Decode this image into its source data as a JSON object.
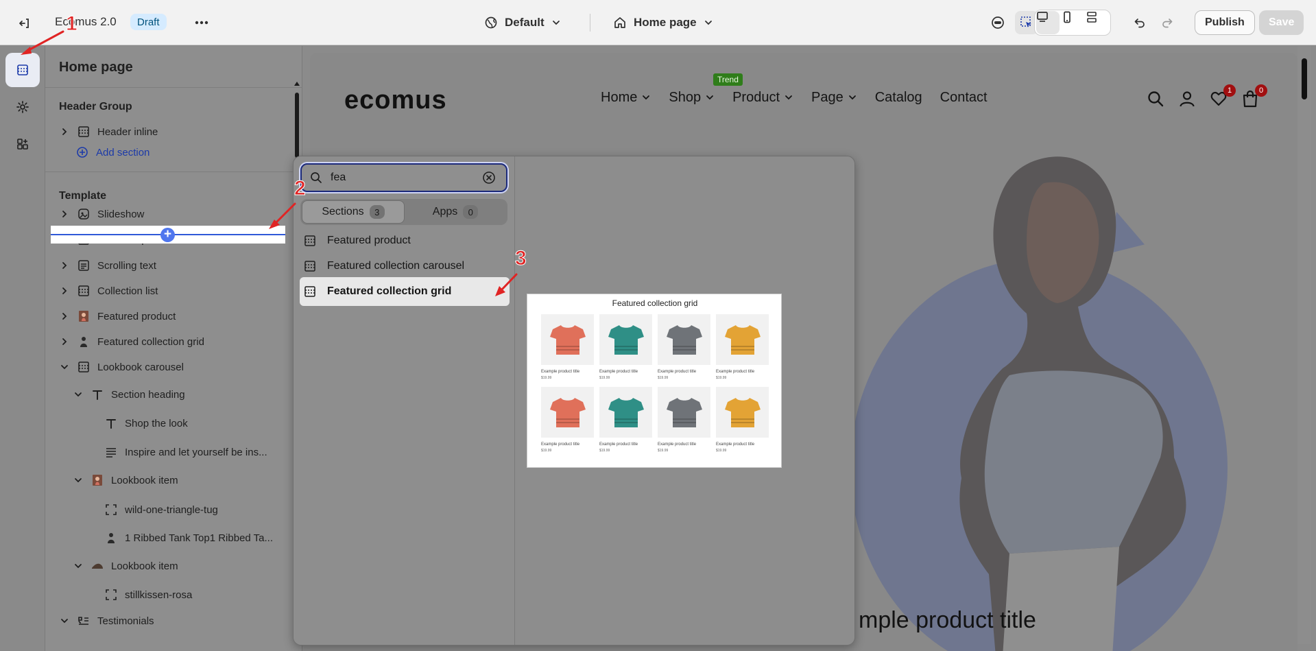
{
  "topbar": {
    "store_name": "Ecomus 2.0",
    "status_badge": "Draft",
    "theme_label": "Default",
    "page_label": "Home page",
    "publish_label": "Publish",
    "save_label": "Save"
  },
  "sidebar": {
    "title": "Home page",
    "header_group_title": "Header Group",
    "header_items": [
      {
        "label": "Header inline",
        "icon": "section-icon"
      }
    ],
    "add_section_label": "Add section",
    "template_title": "Template",
    "template_items": [
      {
        "label": "Slideshow",
        "icon": "slideshow-icon",
        "level": 0,
        "chevron": "right"
      },
      {
        "label": "Featured product",
        "icon": "section-icon",
        "level": 0,
        "chevron": "right"
      },
      {
        "label": "Scrolling text",
        "icon": "text-block-icon",
        "level": 0,
        "chevron": "right"
      },
      {
        "label": "Collection list",
        "icon": "section-icon",
        "level": 0,
        "chevron": "right"
      },
      {
        "label": "Featured product",
        "icon": "product-thumb-icon",
        "level": 0,
        "chevron": "right"
      },
      {
        "label": "Featured collection grid",
        "icon": "figure-thumb-icon",
        "level": 0,
        "chevron": "right"
      },
      {
        "label": "Lookbook carousel",
        "icon": "section-icon",
        "level": 0,
        "chevron": "down"
      },
      {
        "label": "Section heading",
        "icon": "text-t-icon",
        "level": 1,
        "chevron": "down"
      },
      {
        "label": "Shop the look",
        "icon": "text-t-icon",
        "level": 2,
        "chevron": "none"
      },
      {
        "label": "Inspire and let yourself be ins...",
        "icon": "paragraph-icon",
        "level": 2,
        "chevron": "none"
      },
      {
        "label": "Lookbook item",
        "icon": "product-thumb-icon",
        "level": 1,
        "chevron": "down"
      },
      {
        "label": "wild-one-triangle-tug",
        "icon": "hotspot-icon",
        "level": 2,
        "chevron": "none"
      },
      {
        "label": "1 Ribbed Tank Top1 Ribbed Ta...",
        "icon": "figure-thumb-icon",
        "level": 2,
        "chevron": "none"
      },
      {
        "label": "Lookbook item",
        "icon": "shoe-thumb-icon",
        "level": 1,
        "chevron": "down"
      },
      {
        "label": "stillkissen-rosa",
        "icon": "hotspot-icon",
        "level": 2,
        "chevron": "none"
      },
      {
        "label": "Testimonials",
        "icon": "testimonial-icon",
        "level": 0,
        "chevron": "down"
      }
    ]
  },
  "popover": {
    "search_value": "fea",
    "tabs": [
      {
        "label": "Sections",
        "count": "3"
      },
      {
        "label": "Apps",
        "count": "0"
      }
    ],
    "results": [
      {
        "label": "Featured product"
      },
      {
        "label": "Featured collection carousel"
      },
      {
        "label": "Featured collection grid"
      }
    ],
    "preview": {
      "title": "Featured collection grid",
      "products": [
        {
          "name": "Example product title",
          "price": "$19.99",
          "color": "#e0705a"
        },
        {
          "name": "Example product title",
          "price": "$19.99",
          "color": "#2f8f86"
        },
        {
          "name": "Example product title",
          "price": "$19.99",
          "color": "#6f7378"
        },
        {
          "name": "Example product title",
          "price": "$19.99",
          "color": "#e3a335"
        },
        {
          "name": "Example product title",
          "price": "$19.99",
          "color": "#e0705a"
        },
        {
          "name": "Example product title",
          "price": "$19.99",
          "color": "#2f8f86"
        },
        {
          "name": "Example product title",
          "price": "$19.99",
          "color": "#6f7378"
        },
        {
          "name": "Example product title",
          "price": "$19.99",
          "color": "#e3a335"
        }
      ]
    }
  },
  "storefront": {
    "logo": "ecomus",
    "nav": [
      {
        "label": "Home",
        "dropdown": true
      },
      {
        "label": "Shop",
        "dropdown": true
      },
      {
        "label": "Product",
        "dropdown": true
      },
      {
        "label": "Page",
        "dropdown": true
      },
      {
        "label": "Catalog",
        "dropdown": false
      },
      {
        "label": "Contact",
        "dropdown": false
      }
    ],
    "trend_badge": "Trend",
    "wishlist_count": "1",
    "cart_count": "0",
    "hero_caption": "mple product title"
  },
  "annotations": [
    "1",
    "2",
    "3"
  ],
  "colors": {
    "accent": "#3059d9",
    "annotation": "#e02424",
    "draft_badge": "#d5ebff"
  }
}
